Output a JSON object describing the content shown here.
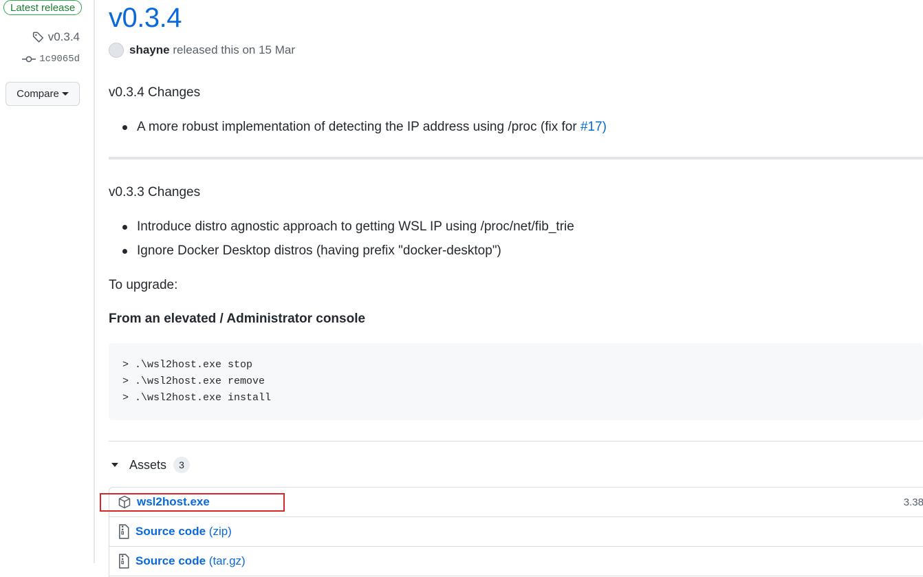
{
  "sidebar": {
    "latest_badge": "Latest release",
    "tag": "v0.3.4",
    "commit": "1c9065d",
    "compare_label": "Compare"
  },
  "release": {
    "title": "v0.3.4",
    "author": "shayne",
    "released_text": "released this on 15 Mar",
    "sections": [
      {
        "heading": "v0.3.4 Changes",
        "bullets": [
          {
            "text": "A more robust implementation of detecting the IP address using /proc (fix for ",
            "link": "#17",
            "suffix": ")"
          }
        ]
      },
      {
        "heading": "v0.3.3 Changes",
        "bullets": [
          {
            "text": "Introduce distro agnostic approach to getting WSL IP using /proc/net/fib_trie"
          },
          {
            "text": "Ignore Docker Desktop distros (having prefix \"docker-desktop\")"
          }
        ]
      }
    ],
    "upgrade_text": "To upgrade:",
    "console_heading": "From an elevated / Administrator console",
    "code_lines": [
      "> .\\wsl2host.exe stop",
      "> .\\wsl2host.exe remove",
      "> .\\wsl2host.exe install"
    ]
  },
  "assets": {
    "label": "Assets",
    "count": "3",
    "items": [
      {
        "name": "wsl2host.exe",
        "ext": "",
        "size": "3.38",
        "icon": "package-icon"
      },
      {
        "name": "Source code",
        "ext": "(zip)",
        "size": "",
        "icon": "file-zip-icon"
      },
      {
        "name": "Source code",
        "ext": "(tar.gz)",
        "size": "",
        "icon": "file-zip-icon"
      }
    ]
  },
  "colors": {
    "link": "#0969da",
    "latest_green": "#1a7f37",
    "highlight_red": "#d62828"
  }
}
